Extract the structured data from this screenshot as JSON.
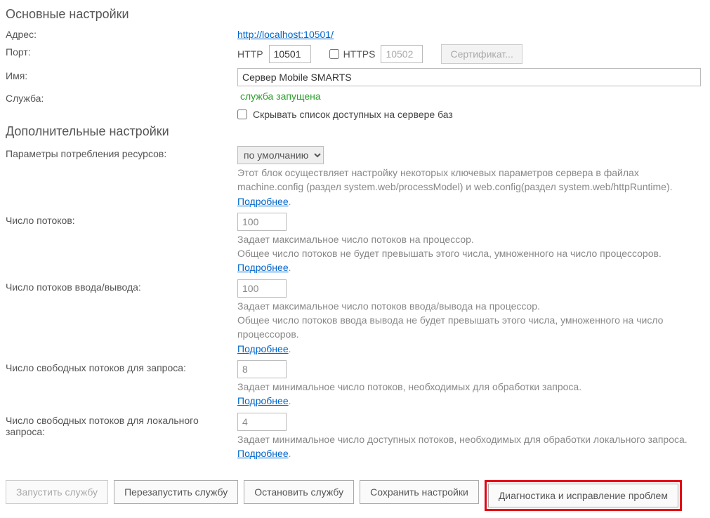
{
  "sections": {
    "basic_title": "Основные настройки",
    "extra_title": "Дополнительные настройки"
  },
  "labels": {
    "address": "Адрес:",
    "port": "Порт:",
    "name": "Имя:",
    "service": "Служба:",
    "resource_params": "Параметры потребления ресурсов:",
    "threads": "Число потоков:",
    "io_threads": "Число потоков ввода/вывода:",
    "free_threads_req": "Число свободных потоков для запроса:",
    "free_threads_local": "Число свободных потоков для локального запроса:"
  },
  "values": {
    "address_url": "http://localhost:10501/",
    "http_label": "HTTP",
    "http_port": "10501",
    "https_label": "HTTPS",
    "https_port": "10502",
    "cert_btn": "Сертификат...",
    "name": "Сервер Mobile SMARTS",
    "service_status": "служба запущена",
    "hide_db_list": "Скрывать список доступных на сервере баз",
    "preset": "по умолчанию",
    "preset_desc": "Этот блок осуществляет настройку некоторых ключевых параметров сервера в файлах machine.config (раздел system.web/processModel) и web.config(раздел system.web/httpRuntime).",
    "more": "Подробнее",
    "threads": "100",
    "threads_desc1": "Задает максимальное число потоков на процессор.",
    "threads_desc2": "Общее число потоков не будет превышать этого числа, умноженного на число процессоров.",
    "io_threads": "100",
    "io_desc1": "Задает максимальное число потоков ввода/вывода на процессор.",
    "io_desc2": "Общее число потоков ввода вывода не будет превышать этого числа, умноженного на число процессоров.",
    "free_req": "8",
    "free_req_desc": "Задает минимальное число потоков, необходимых для обработки запроса.",
    "free_local": "4",
    "free_local_desc": "Задает минимальное число доступных потоков, необходимых для обработки локального запроса."
  },
  "buttons": {
    "start": "Запустить службу",
    "restart": "Перезапустить службу",
    "stop": "Остановить службу",
    "save": "Сохранить настройки",
    "diag": "Диагностика и исправление проблем"
  }
}
